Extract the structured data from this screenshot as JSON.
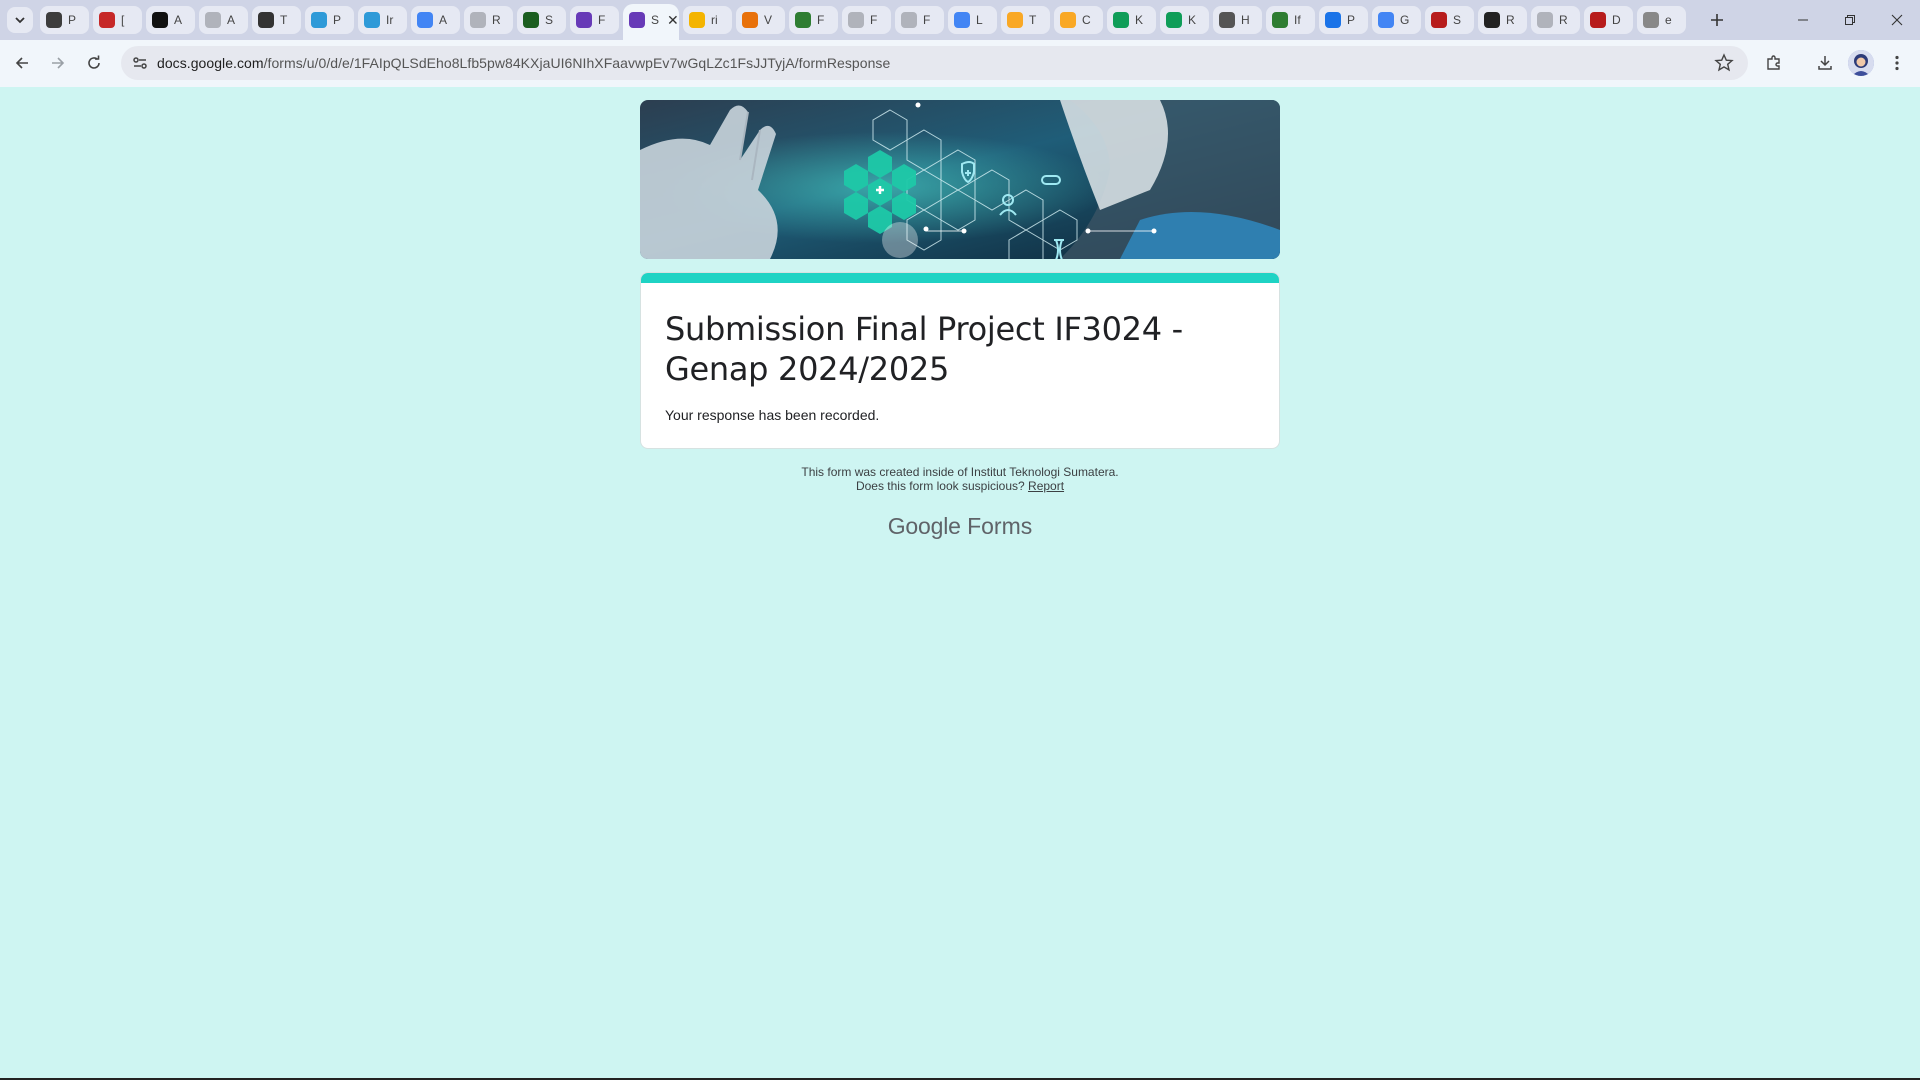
{
  "browser": {
    "tabs": [
      {
        "letter": "P",
        "icon": "openai-icon",
        "color": "#3c3c3c"
      },
      {
        "letter": "[",
        "icon": "red-arrow-icon",
        "color": "#c62828"
      },
      {
        "letter": "A",
        "icon": "n-icon",
        "color": "#111111"
      },
      {
        "letter": "A",
        "icon": "gray-globe-icon",
        "color": "#b0b3bb"
      },
      {
        "letter": "T",
        "icon": "sn-icon",
        "color": "#333333"
      },
      {
        "letter": "P",
        "icon": "wave-icon",
        "color": "#2e9ad8"
      },
      {
        "letter": "Ir",
        "icon": "wave-icon",
        "color": "#2e9ad8"
      },
      {
        "letter": "A",
        "icon": "google-icon",
        "color": "#4285f4"
      },
      {
        "letter": "R",
        "icon": "gray-globe-icon",
        "color": "#b0b3bb"
      },
      {
        "letter": "S",
        "icon": "m-icon",
        "color": "#1b5e20"
      },
      {
        "letter": "F",
        "icon": "forms-icon",
        "color": "#673ab7"
      },
      {
        "letter": "S",
        "icon": "forms-icon",
        "color": "#673ab7",
        "active": true
      },
      {
        "letter": "ri",
        "icon": "drive-icon",
        "color": "#f4b400"
      },
      {
        "letter": "V",
        "icon": "e-icon",
        "color": "#e8710a"
      },
      {
        "letter": "F",
        "icon": "leaf-icon",
        "color": "#2e7d32"
      },
      {
        "letter": "F",
        "icon": "gray-globe-icon",
        "color": "#b0b3bb"
      },
      {
        "letter": "F",
        "icon": "gray-globe-icon",
        "color": "#b0b3bb"
      },
      {
        "letter": "L",
        "icon": "docs-icon",
        "color": "#4285f4"
      },
      {
        "letter": "T",
        "icon": "blob-icon",
        "color": "#f9a825"
      },
      {
        "letter": "C",
        "icon": "blob-icon",
        "color": "#f9a825"
      },
      {
        "letter": "K",
        "icon": "sheets-icon",
        "color": "#0f9d58"
      },
      {
        "letter": "K",
        "icon": "sheets-icon",
        "color": "#0f9d58"
      },
      {
        "letter": "H",
        "icon": "history-icon",
        "color": "#555555"
      },
      {
        "letter": "If",
        "icon": "leaf-icon",
        "color": "#2e7d32"
      },
      {
        "letter": "P",
        "icon": "chat-icon",
        "color": "#1a73e8"
      },
      {
        "letter": "G",
        "icon": "sparkle-icon",
        "color": "#4285f4"
      },
      {
        "letter": "S",
        "icon": "scihub-icon",
        "color": "#b71c1c"
      },
      {
        "letter": "R",
        "icon": "rg-icon",
        "color": "#222222"
      },
      {
        "letter": "R",
        "icon": "gray-globe-icon",
        "color": "#b0b3bb"
      },
      {
        "letter": "D",
        "icon": "scihub-icon",
        "color": "#b71c1c"
      },
      {
        "letter": "e",
        "icon": "github-icon",
        "color": "#888888"
      }
    ],
    "url_host": "docs.google.com",
    "url_path": "/forms/u/0/d/e/1FAIpQLSdEho8Lfb5pw84KXjaUI6NIhXFaavwpEv7wGqLZc1FsJJTyjA/formResponse"
  },
  "form": {
    "title": "Submission Final Project IF3024 - Genap 2024/2025",
    "message": "Your response has been recorded.",
    "footer_line1": "This form was created inside of Institut Teknologi Sumatera.",
    "footer_line2": "Does this form look suspicious?",
    "report_link": "Report",
    "brand_google": "Google",
    "brand_forms": "Forms",
    "accent_color": "#1fd3c4",
    "background_color": "#cef5f2"
  }
}
